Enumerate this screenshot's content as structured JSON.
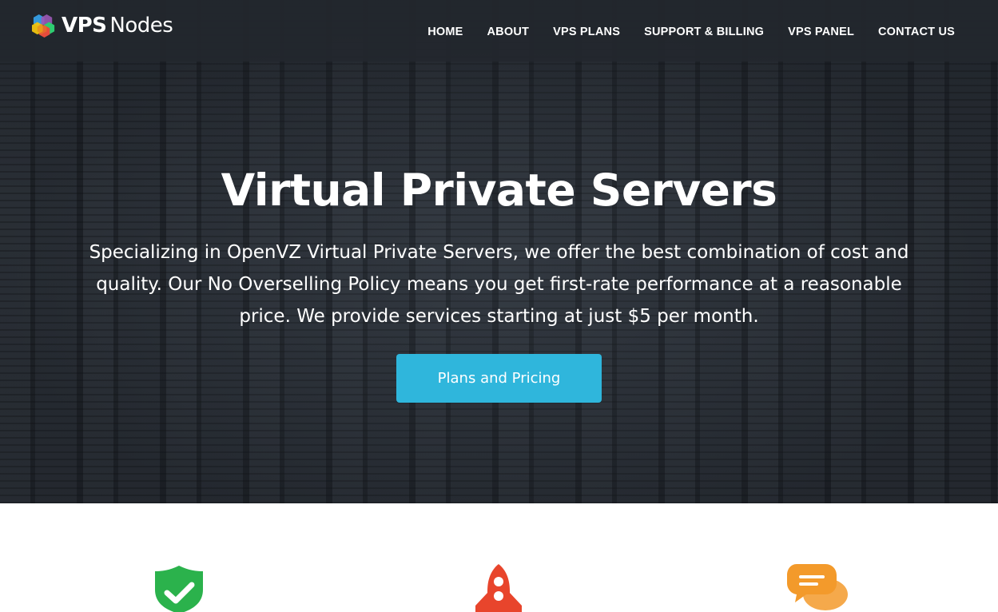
{
  "brand": {
    "name_bold": "VPS",
    "name_light": "Nodes",
    "logo_colors": [
      "#e74c3c",
      "#f1c40f",
      "#2ecc71",
      "#3498db",
      "#9b59b6"
    ]
  },
  "nav": {
    "items": [
      {
        "label": "HOME"
      },
      {
        "label": "ABOUT"
      },
      {
        "label": "VPS PLANS"
      },
      {
        "label": "SUPPORT & BILLING"
      },
      {
        "label": "VPS PANEL"
      },
      {
        "label": "CONTACT US"
      }
    ]
  },
  "hero": {
    "title": "Virtual Private Servers",
    "description": "Specializing in OpenVZ Virtual Private Servers, we offer the best combination of cost and quality. Our No Overselling Policy means you get first-rate performance at a reasonable price. We provide services starting at just $5 per month.",
    "cta_label": "Plans and Pricing",
    "cta_color": "#2fb6dc"
  },
  "features": {
    "icons": [
      {
        "name": "shield-check-icon",
        "color": "#2bb24c"
      },
      {
        "name": "rocket-icon",
        "color": "#e8452c"
      },
      {
        "name": "chat-bubbles-icon",
        "color": "#f39a2b"
      }
    ]
  }
}
